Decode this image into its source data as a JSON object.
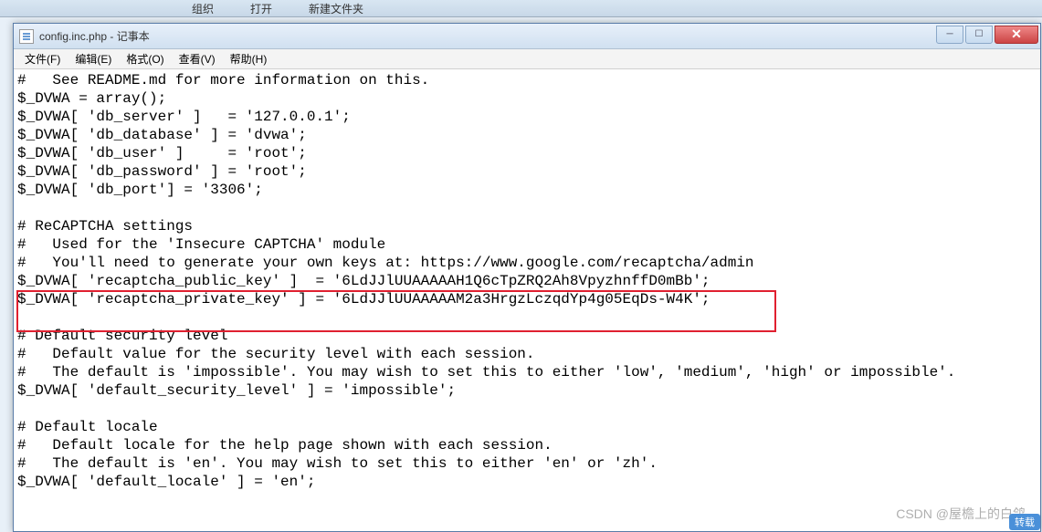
{
  "explorer_toolbar": {
    "organize": "组织",
    "open": "打开",
    "new_folder": "新建文件夹"
  },
  "window": {
    "title": "config.inc.php - 记事本"
  },
  "menubar": {
    "file": "文件(F)",
    "edit": "编辑(E)",
    "format": "格式(O)",
    "view": "查看(V)",
    "help": "帮助(H)"
  },
  "code_lines": [
    "#   See README.md for more information on this.",
    "$_DVWA = array();",
    "$_DVWA[ 'db_server' ]   = '127.0.0.1';",
    "$_DVWA[ 'db_database' ] = 'dvwa';",
    "$_DVWA[ 'db_user' ]     = 'root';",
    "$_DVWA[ 'db_password' ] = 'root';",
    "$_DVWA[ 'db_port'] = '3306';",
    "",
    "# ReCAPTCHA settings",
    "#   Used for the 'Insecure CAPTCHA' module",
    "#   You'll need to generate your own keys at: https://www.google.com/recaptcha/admin",
    "$_DVWA[ 'recaptcha_public_key' ]  = '6LdJJlUUAAAAAH1Q6cTpZRQ2Ah8VpyzhnffD0mBb';",
    "$_DVWA[ 'recaptcha_private_key' ] = '6LdJJlUUAAAAAM2a3HrgzLczqdYp4g05EqDs-W4K';",
    "",
    "# Default security level",
    "#   Default value for the security level with each session.",
    "#   The default is 'impossible'. You may wish to set this to either 'low', 'medium', 'high' or impossible'.",
    "$_DVWA[ 'default_security_level' ] = 'impossible';",
    "",
    "# Default locale",
    "#   Default locale for the help page shown with each session.",
    "#   The default is 'en'. You may wish to set this to either 'en' or 'zh'.",
    "$_DVWA[ 'default_locale' ] = 'en';",
    ""
  ],
  "watermark": "CSDN @屋檐上的白鸽",
  "corner": "转载"
}
